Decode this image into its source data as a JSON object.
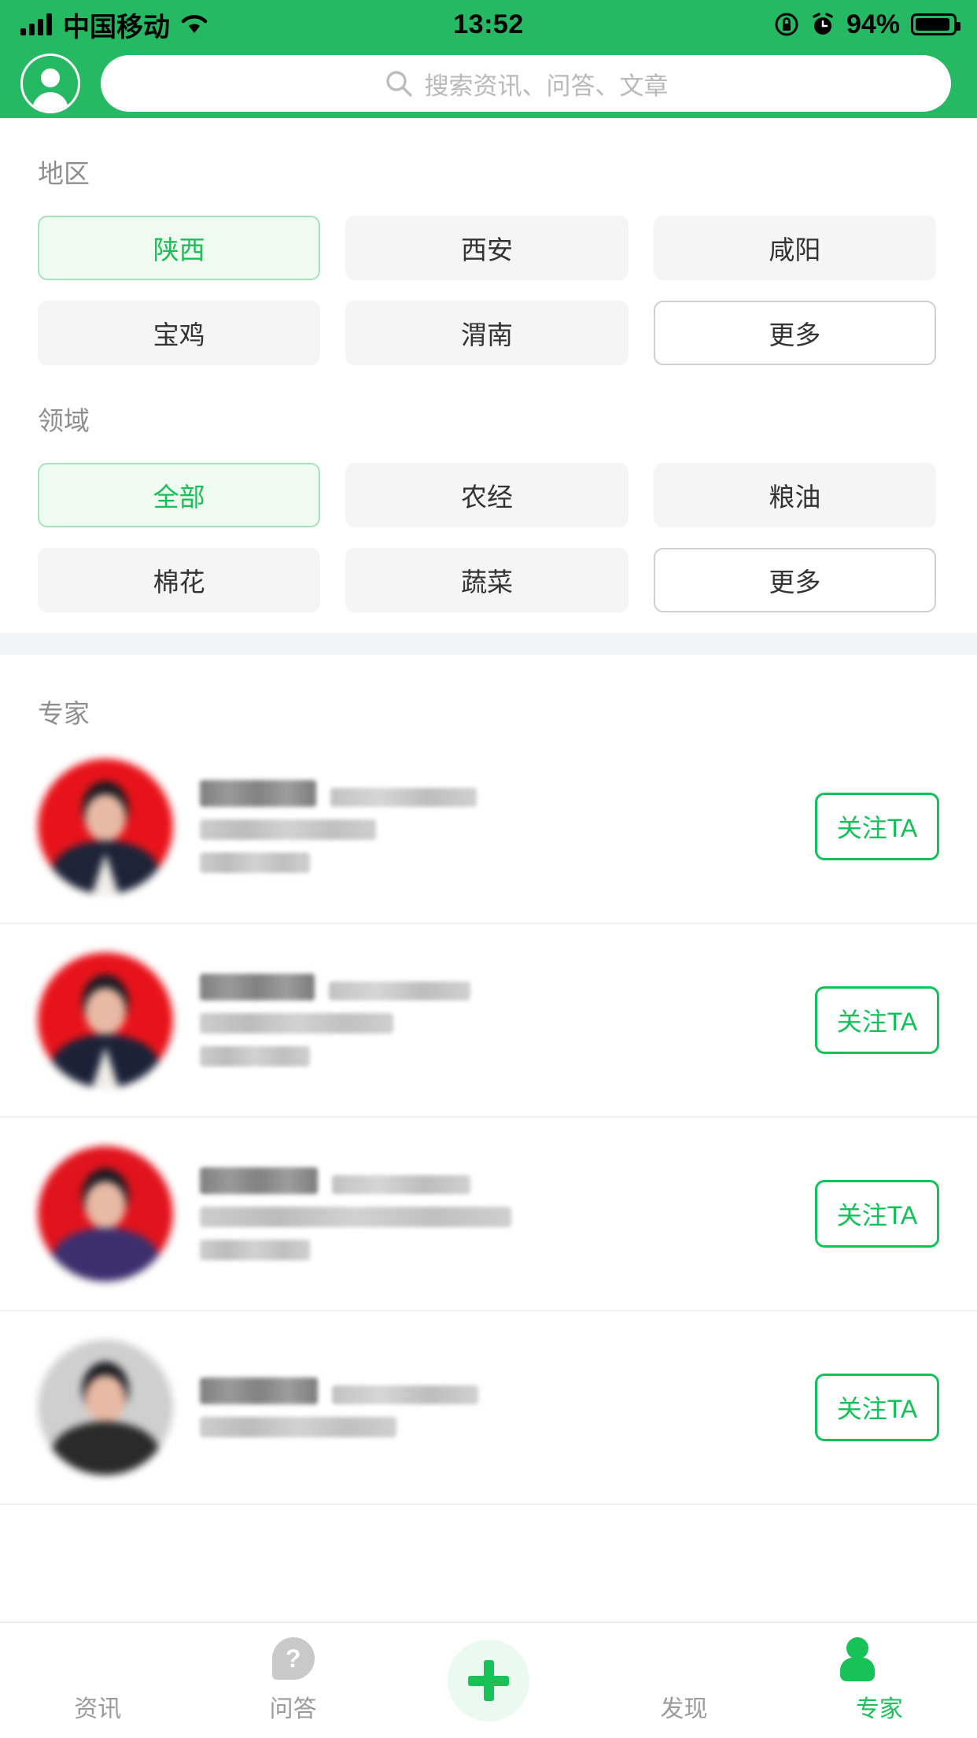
{
  "status_bar": {
    "carrier": "中国移动",
    "time": "13:52",
    "battery_percent": "94%",
    "icons": [
      "signal-bars-icon",
      "wifi-icon",
      "rotation-lock-icon",
      "alarm-clock-icon",
      "battery-icon"
    ]
  },
  "header": {
    "avatar_icon": "user-avatar-icon",
    "search_icon": "search-icon",
    "search_placeholder": "搜索资讯、问答、文章",
    "search_value": ""
  },
  "filters": [
    {
      "key": "region",
      "title": "地区",
      "chips": [
        {
          "label": "陕西",
          "state": "selected"
        },
        {
          "label": "西安",
          "state": "default"
        },
        {
          "label": "咸阳",
          "state": "default"
        },
        {
          "label": "宝鸡",
          "state": "default"
        },
        {
          "label": "渭南",
          "state": "default"
        },
        {
          "label": "更多",
          "state": "more"
        }
      ]
    },
    {
      "key": "field",
      "title": "领域",
      "chips": [
        {
          "label": "全部",
          "state": "selected"
        },
        {
          "label": "农经",
          "state": "default"
        },
        {
          "label": "粮油",
          "state": "default"
        },
        {
          "label": "棉花",
          "state": "default"
        },
        {
          "label": "蔬菜",
          "state": "default"
        },
        {
          "label": "更多",
          "state": "more"
        }
      ]
    }
  ],
  "experts_section": {
    "title": "专家",
    "follow_label": "关注TA",
    "rows": [
      {
        "name": "[已模糊]",
        "subtitle": "[已模糊]",
        "org": "[已模糊]",
        "role": "[已模糊]",
        "avatar_bg": "#e8131a",
        "avatar_outfit": "#1d2438",
        "redacted": true
      },
      {
        "name": "[已模糊]",
        "subtitle": "[已模糊]",
        "org": "[已模糊]",
        "role": "[已模糊]",
        "avatar_bg": "#e8131a",
        "avatar_outfit": "#1b2238",
        "redacted": true
      },
      {
        "name": "[已模糊]",
        "subtitle": "[已模糊]",
        "org": "[已模糊]",
        "role": "[已模糊]",
        "avatar_bg": "#e1131d",
        "avatar_outfit": "#3c2f6e",
        "redacted": true
      },
      {
        "name": "[已模糊]",
        "subtitle": "[已模糊]",
        "org": "[已模糊]",
        "role": "[已模糊]",
        "avatar_bg": "#cfcfcf",
        "avatar_outfit": "#2a2a2a",
        "redacted": true
      }
    ]
  },
  "tab_bar": {
    "items": [
      {
        "label": "资讯",
        "icon": "bookmark-icon",
        "active": false
      },
      {
        "label": "问答",
        "icon": "question-mark-icon",
        "active": false
      },
      {
        "label": "",
        "icon": "plus-icon",
        "active": false
      },
      {
        "label": "发现",
        "icon": "compass-icon",
        "active": false
      },
      {
        "label": "专家",
        "icon": "person-icon",
        "active": true
      }
    ]
  },
  "colors": {
    "brand_green": "#26b964",
    "accent_green": "#17c257",
    "selected_chip_bg": "#effaf1",
    "selected_chip_border": "#a8e2bb",
    "chip_bg": "#f5f5f5",
    "band_gray": "#f3f4f5",
    "muted_text": "#8e8e8e"
  }
}
